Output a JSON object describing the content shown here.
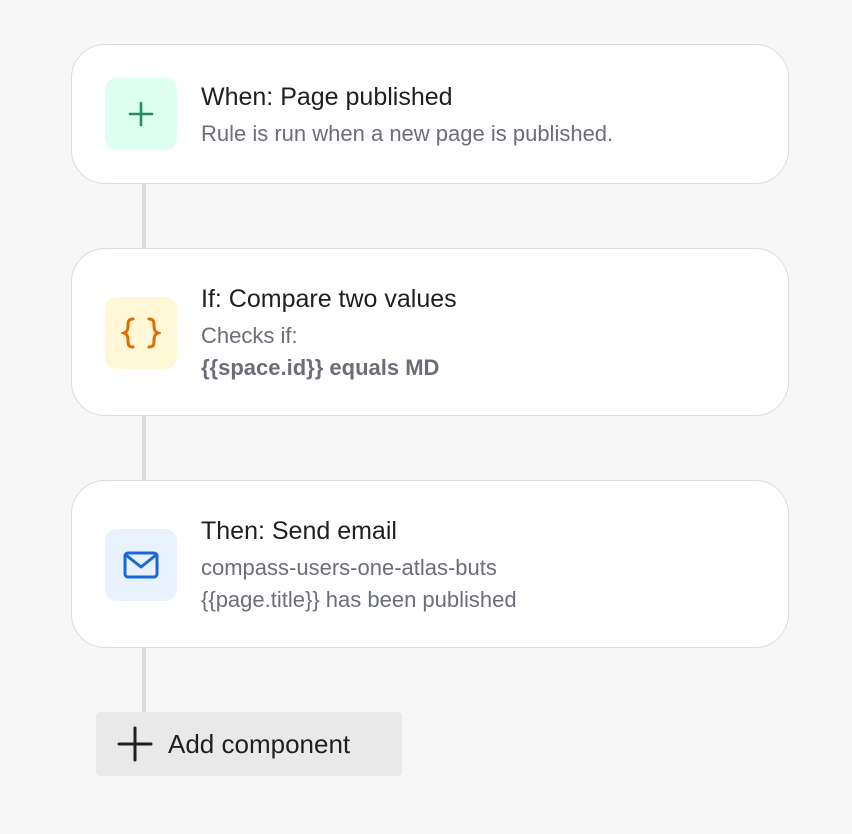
{
  "rules": [
    {
      "title": "When: Page published",
      "lines": [
        "Rule is run when a new page is published."
      ],
      "icon": "plus-icon",
      "icon_bg": "#dcfff1",
      "icon_color": "#1f8f5f"
    },
    {
      "title": "If: Compare two values",
      "lines": [
        "Checks if:",
        "{{space.id}} equals MD"
      ],
      "icon": "curly-braces-icon",
      "icon_bg": "#fff7d6",
      "icon_color": "#e06c00"
    },
    {
      "title": "Then: Send email",
      "lines": [
        "compass-users-one-atlas-buts",
        "{{page.title}} has been published"
      ],
      "icon": "envelope-icon",
      "icon_bg": "#e9f2ff",
      "icon_color": "#1868db"
    }
  ],
  "add_component": {
    "label": "Add component",
    "icon": "plus-icon"
  }
}
